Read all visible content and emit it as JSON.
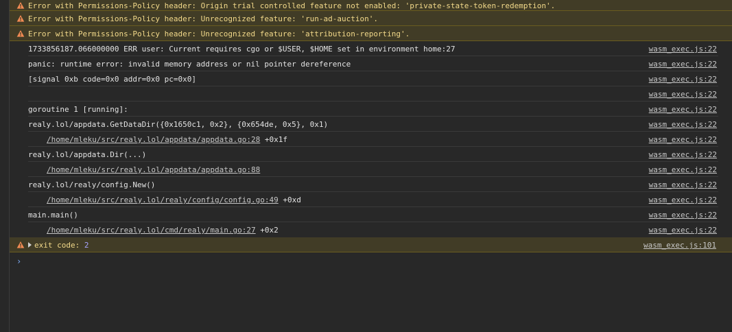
{
  "warnings": [
    {
      "text": "Error with Permissions-Policy header: Origin trial controlled feature not enabled: 'private-state-token-redemption'."
    },
    {
      "text": "Error with Permissions-Policy header: Unrecognized feature: 'run-ad-auction'."
    },
    {
      "text": "Error with Permissions-Policy header: Unrecognized feature: 'attribution-reporting'."
    }
  ],
  "logs": [
    {
      "text": "1733856187.066000000 ERR user: Current requires cgo or $USER, $HOME set in environment home:27",
      "src": "wasm_exec.js:22"
    },
    {
      "text": "panic: runtime error: invalid memory address or nil pointer dereference",
      "src": "wasm_exec.js:22"
    },
    {
      "text": "[signal 0xb code=0x0 addr=0x0 pc=0x0]",
      "src": "wasm_exec.js:22"
    },
    {
      "text": "",
      "src": "wasm_exec.js:22"
    },
    {
      "text": "goroutine 1 [running]:",
      "src": "wasm_exec.js:22"
    },
    {
      "text": "realy.lol/appdata.GetDataDir({0x1650c1, 0x2}, {0x654de, 0x5}, 0x1)",
      "src": "wasm_exec.js:22"
    },
    {
      "path": "/home/mleku/src/realy.lol/appdata/appdata.go:28",
      "suffix": " +0x1f",
      "src": "wasm_exec.js:22"
    },
    {
      "text": "realy.lol/appdata.Dir(...)",
      "src": "wasm_exec.js:22"
    },
    {
      "path": "/home/mleku/src/realy.lol/appdata/appdata.go:88",
      "suffix": "",
      "src": "wasm_exec.js:22"
    },
    {
      "text": "realy.lol/realy/config.New()",
      "src": "wasm_exec.js:22"
    },
    {
      "path": "/home/mleku/src/realy.lol/realy/config/config.go:49",
      "suffix": " +0xd",
      "src": "wasm_exec.js:22"
    },
    {
      "text": "main.main()",
      "src": "wasm_exec.js:22"
    },
    {
      "path": "/home/mleku/src/realy.lol/cmd/realy/main.go:27",
      "suffix": " +0x2",
      "src": "wasm_exec.js:22"
    }
  ],
  "exit": {
    "label": "exit code: ",
    "value": "2",
    "src": "wasm_exec.js:101"
  },
  "prompt": {
    "symbol": "›"
  },
  "colors": {
    "background": "#282828",
    "warning_bg": "#413c26",
    "warning_text": "#f2d98a",
    "warning_icon": "#f28b54",
    "prompt": "#7cacf8"
  }
}
